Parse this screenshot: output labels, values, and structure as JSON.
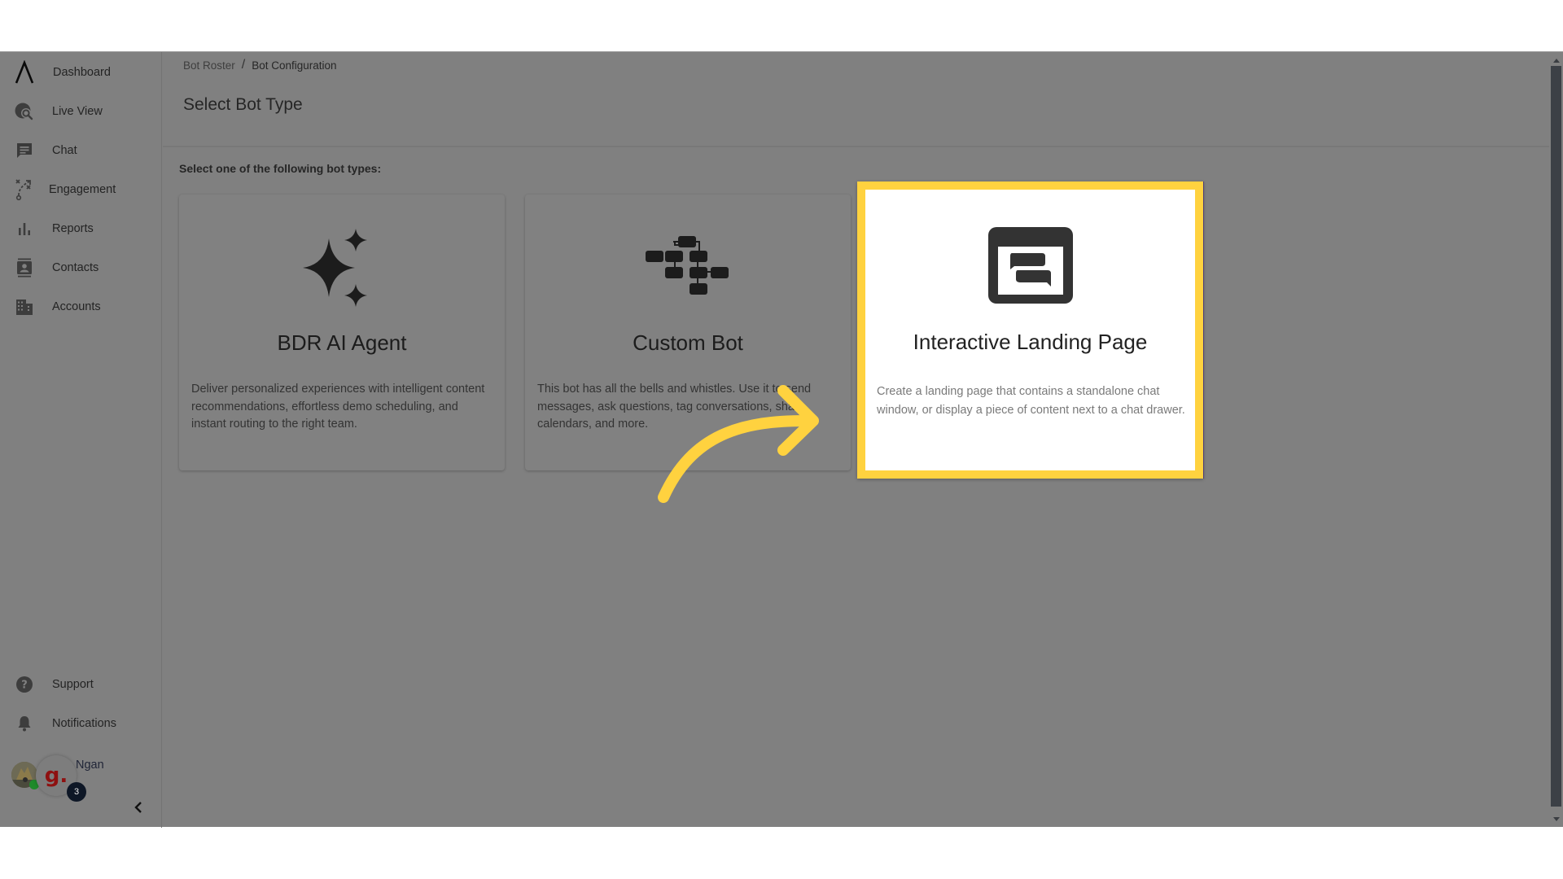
{
  "sidebar": {
    "items": [
      {
        "label": "Dashboard",
        "icon": "logo-chevron-icon"
      },
      {
        "label": "Live View",
        "icon": "globe-search-icon"
      },
      {
        "label": "Chat",
        "icon": "chat-bubble-icon"
      },
      {
        "label": "Engagement",
        "icon": "playbook-icon"
      },
      {
        "label": "Reports",
        "icon": "bar-chart-icon"
      },
      {
        "label": "Contacts",
        "icon": "contact-card-icon"
      },
      {
        "label": "Accounts",
        "icon": "building-icon"
      }
    ],
    "bottom_items": [
      {
        "label": "Support",
        "icon": "help-icon"
      },
      {
        "label": "Notifications",
        "icon": "bell-icon"
      }
    ],
    "user": {
      "name": "Ngan",
      "widget_glyph": "g.",
      "badge_count": "3",
      "status_color": "#1f8a2a"
    },
    "collapse_glyph": "‹"
  },
  "breadcrumb": {
    "parent": "Bot Roster",
    "separator": "/",
    "current": "Bot Configuration"
  },
  "page": {
    "title": "Select Bot Type",
    "instructions": "Select one of the following bot types:"
  },
  "cards": [
    {
      "title": "BDR AI Agent",
      "description": "Deliver personalized experiences with intelligent content recommendations, effortless demo scheduling, and instant routing to the right team.",
      "icon": "sparkles-icon"
    },
    {
      "title": "Custom Bot",
      "description": "This bot has all the bells and whistles. Use it to send messages, ask questions, tag conversations, share calendars, and more.",
      "icon": "flowchart-icon"
    },
    {
      "title": "Interactive Landing Page",
      "description": "Create a landing page that contains a standalone chat window, or display a piece of content next to a chat drawer.",
      "icon": "landing-page-chat-icon",
      "highlighted": true
    }
  ],
  "annotation": {
    "highlight_color": "#ffd23f",
    "arrow_color": "#ffd23f"
  }
}
